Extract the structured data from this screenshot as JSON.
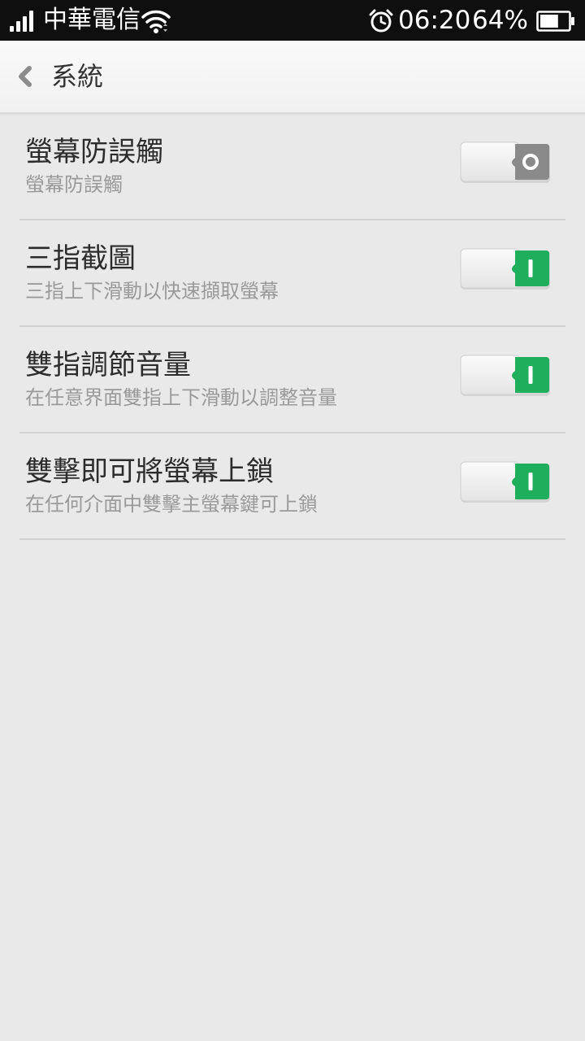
{
  "status_bar": {
    "carrier": "中華電信",
    "time": "06:20",
    "battery_percent": "64%",
    "battery_level": 0.64,
    "icons": [
      "signal-icon",
      "wifi-icon",
      "alarm-icon",
      "battery-icon"
    ]
  },
  "header": {
    "back_icon": "chevron-left-icon",
    "title": "系統"
  },
  "settings": [
    {
      "title": "螢幕防誤觸",
      "subtitle": "螢幕防誤觸",
      "enabled": false
    },
    {
      "title": "三指截圖",
      "subtitle": "三指上下滑動以快速擷取螢幕",
      "enabled": true
    },
    {
      "title": "雙指調節音量",
      "subtitle": "在任意界面雙指上下滑動以調整音量",
      "enabled": true
    },
    {
      "title": "雙擊即可將螢幕上鎖",
      "subtitle": "在任何介面中雙擊主螢幕鍵可上鎖",
      "enabled": true
    }
  ],
  "colors": {
    "toggle_on": "#1fae5b",
    "toggle_off": "#8a8a8a",
    "background": "#e9e9e9",
    "status_bar": "#0f0f0f"
  }
}
